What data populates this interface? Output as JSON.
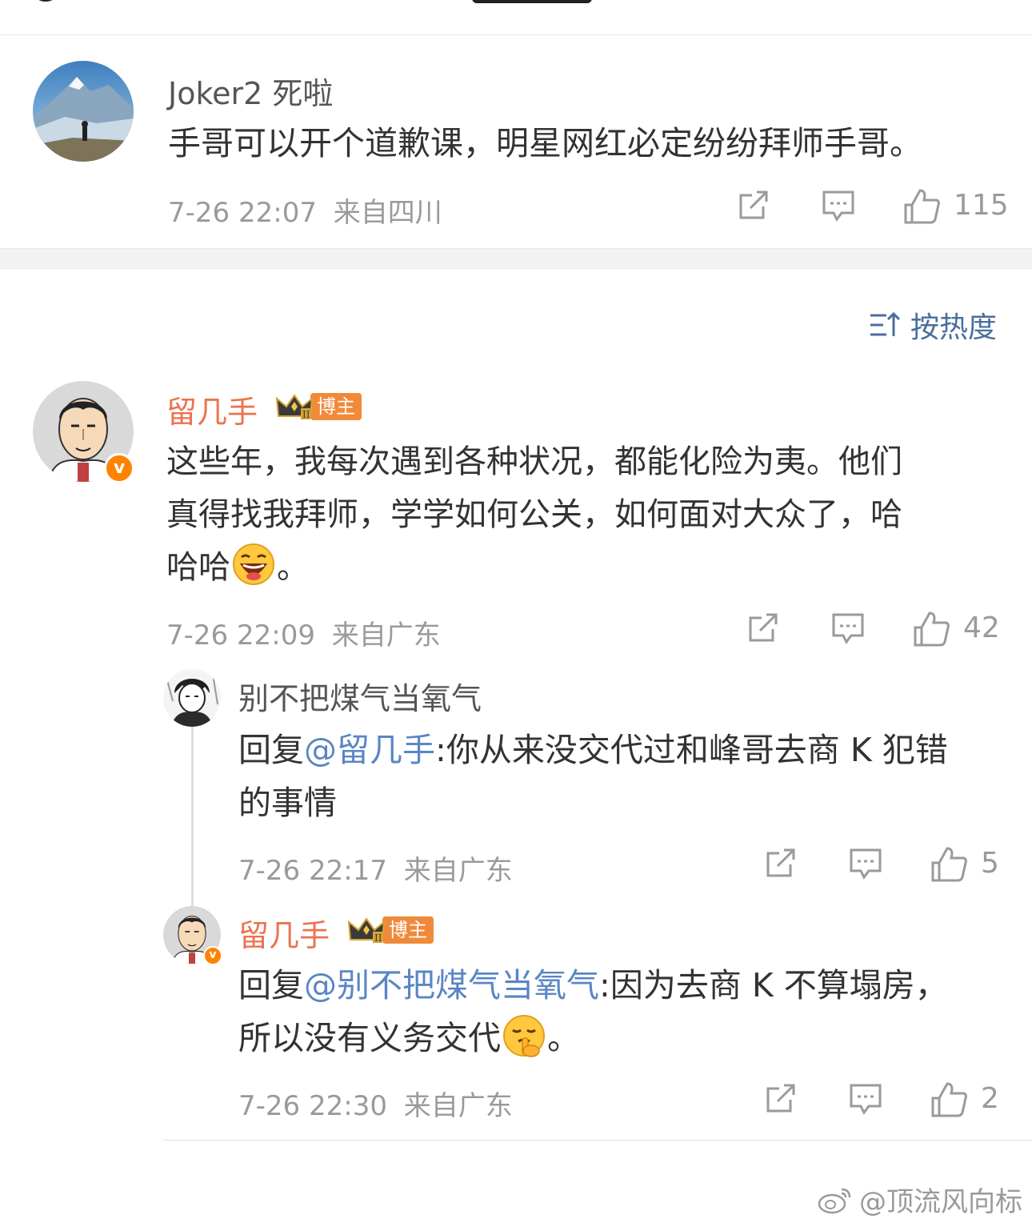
{
  "comments": [
    {
      "username": "Joker2 死啦",
      "content": "手哥可以开个道歉课，明星网红必定纷纷拜师手哥。",
      "time": "7-26 22:07",
      "location": "来自四川",
      "likes": "115"
    },
    {
      "username": "留几手",
      "badge": "博主",
      "content_line1": "这些年，我每次遇到各种状况，都能化险为夷。他们",
      "content_line2": "真得找我拜师，学学如何公关，如何面对大众了，哈",
      "content_line3a": "哈哈",
      "content_line3b": "。",
      "emoji": "laughing-emoji",
      "time": "7-26 22:09",
      "location": "来自广东",
      "likes": "42"
    }
  ],
  "replies": [
    {
      "username": "别不把煤气当氧气",
      "prefix": "回复",
      "mention": "@留几手",
      "content_line1_rest": ":你从来没交代过和峰哥去商 K 犯错",
      "content_line2": "的事情",
      "time": "7-26 22:17",
      "location": "来自广东",
      "likes": "5"
    },
    {
      "username": "留几手",
      "badge": "博主",
      "prefix": "回复",
      "mention": "@别不把煤气当氧气",
      "content_line1_rest": ":因为去商 K 不算塌房，",
      "content_line2a": "所以没有义务交代",
      "content_line2b": "。",
      "emoji": "shush-emoji",
      "time": "7-26 22:30",
      "location": "来自广东",
      "likes": "2"
    }
  ],
  "sort": {
    "label": "按热度",
    "icon": "sort-icon"
  },
  "watermark": "@顶流风向标",
  "colors": {
    "accent_orange": "#eb7350",
    "mention_blue": "#5a86c4",
    "meta_gray": "#9a9a9a",
    "sort_blue": "#4a6e9c"
  }
}
